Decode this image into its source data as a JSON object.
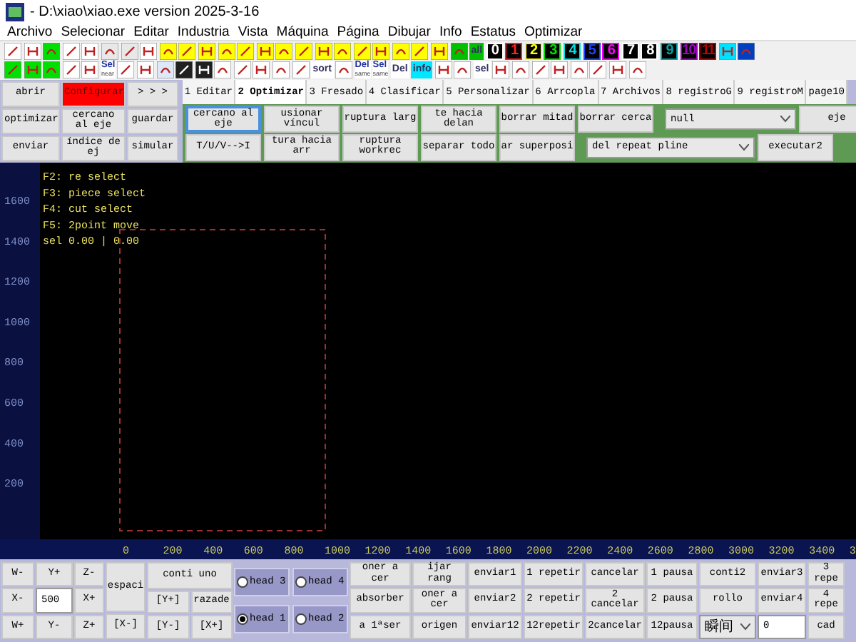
{
  "window": {
    "title": "- D:\\xiao\\xiao.exe version 2025-3-16"
  },
  "menu": [
    "Archivo",
    "Selecionar",
    "Editar",
    "Industria",
    "Vista",
    "Máquina",
    "Página",
    "Dibujar",
    "Info",
    "Estatus",
    "Optimizar"
  ],
  "toolbar": {
    "rows": [
      [
        {
          "kind": "icon",
          "color": "#ffffff"
        },
        {
          "kind": "icon",
          "color": "#ffffff"
        },
        {
          "kind": "icon",
          "color": "#00e000"
        },
        {
          "kind": "icon",
          "color": "#ffffff"
        },
        {
          "kind": "icon",
          "color": "#ffffff"
        },
        {
          "kind": "icon",
          "color": "#e8e8e8"
        },
        {
          "kind": "icon",
          "color": "#e8e8e8"
        },
        {
          "kind": "icon",
          "color": "#ffffff"
        },
        {
          "kind": "icon",
          "color": "#ffff00"
        },
        {
          "kind": "icon",
          "color": "#ffff00"
        },
        {
          "kind": "icon",
          "color": "#ffff00"
        },
        {
          "kind": "icon",
          "color": "#ffff00"
        },
        {
          "kind": "icon",
          "color": "#ffff00"
        },
        {
          "kind": "icon",
          "color": "#ffff00"
        },
        {
          "kind": "icon",
          "color": "#ffff00"
        },
        {
          "kind": "icon",
          "color": "#ffff00"
        },
        {
          "kind": "icon",
          "color": "#ffff00"
        },
        {
          "kind": "icon",
          "color": "#ffff00"
        },
        {
          "kind": "icon",
          "color": "#ffff00"
        },
        {
          "kind": "icon",
          "color": "#ffff00"
        },
        {
          "kind": "icon",
          "color": "#ffff00"
        },
        {
          "kind": "icon",
          "color": "#ffff00"
        },
        {
          "kind": "icon",
          "color": "#ffff00"
        },
        {
          "kind": "icon",
          "color": "#00c000"
        },
        {
          "kind": "label",
          "text": "all",
          "color": "#00c000"
        },
        {
          "kind": "num",
          "text": "0",
          "color": "#ffffff"
        },
        {
          "kind": "num",
          "text": "1",
          "color": "#ff2020"
        },
        {
          "kind": "num",
          "text": "2",
          "color": "#ffff00"
        },
        {
          "kind": "num",
          "text": "3",
          "color": "#00e000"
        },
        {
          "kind": "num",
          "text": "4",
          "color": "#00e0e0"
        },
        {
          "kind": "num",
          "text": "5",
          "color": "#2040ff"
        },
        {
          "kind": "num",
          "text": "6",
          "color": "#ff00ff"
        },
        {
          "kind": "num",
          "text": "7",
          "color": "#ffffff"
        },
        {
          "kind": "num",
          "text": "8",
          "color": "#ffffff"
        },
        {
          "kind": "num",
          "text": "9",
          "color": "#00a0a0"
        },
        {
          "kind": "num",
          "text": "10",
          "color": "#a000c0"
        },
        {
          "kind": "num",
          "text": "11",
          "color": "#c00000"
        },
        {
          "kind": "icon",
          "color": "#00e0ff"
        },
        {
          "kind": "icon",
          "color": "#0040c0"
        }
      ],
      [
        {
          "kind": "icon",
          "color": "#00e000"
        },
        {
          "kind": "icon",
          "color": "#00e000"
        },
        {
          "kind": "icon",
          "color": "#00e000"
        },
        {
          "kind": "icon",
          "color": "#ffffff"
        },
        {
          "kind": "icon",
          "color": "#ffffff"
        },
        {
          "kind": "stack",
          "text": "Sel",
          "sub": "near",
          "color": "#ffffff"
        },
        {
          "kind": "icon",
          "color": "#ffffff"
        },
        {
          "kind": "icon",
          "color": "#ffffff"
        },
        {
          "kind": "icon",
          "color": "#dde8f8"
        },
        {
          "kind": "icon",
          "color": "#202020"
        },
        {
          "kind": "icon",
          "color": "#202020"
        },
        {
          "kind": "icon",
          "color": "#ffffff"
        },
        {
          "kind": "icon",
          "color": "#ffffff"
        },
        {
          "kind": "icon",
          "color": "#ffffff"
        },
        {
          "kind": "icon",
          "color": "#ffffff"
        },
        {
          "kind": "icon",
          "color": "#ffffff"
        },
        {
          "kind": "label",
          "text": "sort",
          "color": "#ffffff"
        },
        {
          "kind": "icon",
          "color": "#ffffff"
        },
        {
          "kind": "stack",
          "text": "Del",
          "sub": "same",
          "color": "#ffffff"
        },
        {
          "kind": "stack",
          "text": "Sel",
          "sub": "same",
          "color": "#ffffff"
        },
        {
          "kind": "label",
          "text": "Del",
          "color": "#ffffff"
        },
        {
          "kind": "label",
          "text": "info",
          "color": "#00e8ff"
        },
        {
          "kind": "icon",
          "color": "#ffffff"
        },
        {
          "kind": "icon",
          "color": "#ffffff"
        },
        {
          "kind": "label",
          "text": "sel",
          "color": "#ffffff"
        },
        {
          "kind": "icon",
          "color": "#ffffff"
        },
        {
          "kind": "icon",
          "color": "#ffffff"
        },
        {
          "kind": "icon",
          "color": "#ffffff"
        },
        {
          "kind": "icon",
          "color": "#ffffff"
        },
        {
          "kind": "icon",
          "color": "#ffffff"
        },
        {
          "kind": "icon",
          "color": "#ffffff"
        },
        {
          "kind": "icon",
          "color": "#ffffff"
        },
        {
          "kind": "icon",
          "color": "#ffffff"
        }
      ]
    ]
  },
  "left_panel": {
    "buttons": [
      {
        "kind": "button",
        "text": "abrir"
      },
      {
        "kind": "alert",
        "text": "Configurar"
      },
      {
        "kind": "button",
        "text": "> > >"
      },
      {
        "kind": "button",
        "text": "optimizar"
      },
      {
        "kind": "button",
        "text": "cercano al eje"
      },
      {
        "kind": "button",
        "text": "guardar"
      },
      {
        "kind": "button",
        "text": "enviar"
      },
      {
        "kind": "button",
        "text": "índice de ej"
      },
      {
        "kind": "button",
        "text": "simular"
      }
    ]
  },
  "tabs": [
    {
      "label": "1 Editar",
      "selected": false
    },
    {
      "label": "2 Optimizar",
      "selected": true
    },
    {
      "label": "3 Fresado",
      "selected": false
    },
    {
      "label": "4 Clasificar",
      "selected": false
    },
    {
      "label": "5 Personalizar",
      "selected": false
    },
    {
      "label": "6 Arrcopla",
      "selected": false
    },
    {
      "label": "7 Archivos",
      "selected": false
    },
    {
      "label": "8 registroG",
      "selected": false
    },
    {
      "label": "9 registroM",
      "selected": false
    },
    {
      "label": "page10",
      "selected": false
    }
  ],
  "tab_panel": {
    "top_line": [
      {
        "kind": "button",
        "text": "cercano al eje",
        "focused": true
      },
      {
        "kind": "button",
        "text": "usionar víncul",
        "focused": false
      },
      {
        "kind": "button",
        "text": "ruptura larg",
        "focused": false
      },
      {
        "kind": "button",
        "text": "te hacia delan",
        "focused": false
      },
      {
        "kind": "button",
        "text": "borrar mitad",
        "focused": false
      },
      {
        "kind": "button",
        "text": "borrar cerca",
        "focused": false
      },
      {
        "kind": "select",
        "text": "null",
        "focused": false
      },
      {
        "kind": "button",
        "text": "eje",
        "focused": false
      }
    ],
    "bottom_line": [
      {
        "kind": "button",
        "text": "T/U/V-->I",
        "focused": false
      },
      {
        "kind": "button",
        "text": "tura hacia arr",
        "focused": false
      },
      {
        "kind": "button",
        "text": "ruptura workrec",
        "focused": false
      },
      {
        "kind": "button",
        "text": "separar todo",
        "focused": false
      },
      {
        "kind": "button",
        "text": "ar superposi",
        "focused": false
      },
      {
        "kind": "select",
        "text": "del repeat pline",
        "focused": false
      },
      {
        "kind": "button",
        "text": "executar2",
        "focused": false
      }
    ]
  },
  "canvas": {
    "console_lines": [
      "F2: re select",
      "F3: piece select",
      "F4: cut select",
      "F5: 2point move",
      "sel 0.00 | 0.00"
    ],
    "y_ruler": [
      "1600",
      "1400",
      "1200",
      "1000",
      "800",
      "600",
      "400",
      "200"
    ],
    "x_ruler": [
      "0",
      "200",
      "400",
      "600",
      "800",
      "1000",
      "1200",
      "1400",
      "1600",
      "1800",
      "2000",
      "2200",
      "2400",
      "2600",
      "2800",
      "3000",
      "3200",
      "3400",
      "3"
    ]
  },
  "bottom_panel": {
    "columns": [
      {
        "kind": "stack",
        "items": [
          {
            "kind": "button",
            "text": "W-"
          },
          {
            "kind": "button",
            "text": "X-"
          },
          {
            "kind": "button",
            "text": "W+"
          }
        ]
      },
      {
        "kind": "stack",
        "items": [
          {
            "kind": "button",
            "text": "Y+"
          },
          {
            "kind": "input",
            "text": "500"
          },
          {
            "kind": "button",
            "text": "Y-"
          }
        ]
      },
      {
        "kind": "stack",
        "items": [
          {
            "kind": "button",
            "text": "Z-"
          },
          {
            "kind": "button",
            "text": "X+"
          },
          {
            "kind": "button",
            "text": "Z+"
          }
        ]
      },
      {
        "kind": "stack",
        "items": [
          {
            "kind": "tall",
            "text": "espaci"
          },
          {
            "kind": "button",
            "text": "[X-]"
          }
        ]
      },
      {
        "kind": "stack",
        "items": [
          {
            "kind": "button",
            "text": "conti uno"
          },
          {
            "kind": "pair",
            "texts": [
              "[Y+]",
              "razade"
            ]
          },
          {
            "kind": "pair",
            "texts": [
              "[Y-]",
              "[X+]"
            ]
          }
        ]
      },
      {
        "kind": "radio",
        "options": [
          {
            "label": "head 3",
            "selected": false
          },
          {
            "label": "head 4",
            "selected": false
          },
          {
            "label": "head 1",
            "selected": true
          },
          {
            "label": "head 2",
            "selected": false
          }
        ]
      },
      {
        "kind": "stack",
        "items": [
          {
            "kind": "button",
            "text": "oner a cer"
          },
          {
            "kind": "button",
            "text": "absorber"
          },
          {
            "kind": "button",
            "text": "a 1ªser"
          }
        ]
      },
      {
        "kind": "stack",
        "items": [
          {
            "kind": "button",
            "text": "ijar rang"
          },
          {
            "kind": "button",
            "text": "oner a cer"
          },
          {
            "kind": "button",
            "text": "origen"
          }
        ]
      },
      {
        "kind": "stack",
        "items": [
          {
            "kind": "button",
            "text": "enviar1"
          },
          {
            "kind": "button",
            "text": "enviar2"
          },
          {
            "kind": "button",
            "text": "enviar12"
          }
        ]
      },
      {
        "kind": "stack",
        "items": [
          {
            "kind": "button",
            "text": "1 repetir"
          },
          {
            "kind": "button",
            "text": "2 repetir"
          },
          {
            "kind": "button",
            "text": "12repetir"
          }
        ]
      },
      {
        "kind": "stack",
        "items": [
          {
            "kind": "button",
            "text": "cancelar"
          },
          {
            "kind": "button",
            "text": "2 cancelar"
          },
          {
            "kind": "button",
            "text": "2cancelar"
          }
        ]
      },
      {
        "kind": "stack",
        "items": [
          {
            "kind": "button",
            "text": "1 pausa"
          },
          {
            "kind": "button",
            "text": "2 pausa"
          },
          {
            "kind": "button",
            "text": "12pausa"
          }
        ]
      },
      {
        "kind": "stack",
        "items": [
          {
            "kind": "button",
            "text": "conti2"
          },
          {
            "kind": "button",
            "text": "rollo"
          },
          {
            "kind": "select",
            "text": "瞬间"
          }
        ]
      },
      {
        "kind": "stack",
        "items": [
          {
            "kind": "button",
            "text": "enviar3"
          },
          {
            "kind": "button",
            "text": "enviar4"
          },
          {
            "kind": "input",
            "text": "0"
          }
        ]
      },
      {
        "kind": "stack",
        "items": [
          {
            "kind": "button",
            "text": "3 repe"
          },
          {
            "kind": "button",
            "text": "4 repe"
          },
          {
            "kind": "button",
            "text": "cad"
          }
        ]
      }
    ]
  }
}
